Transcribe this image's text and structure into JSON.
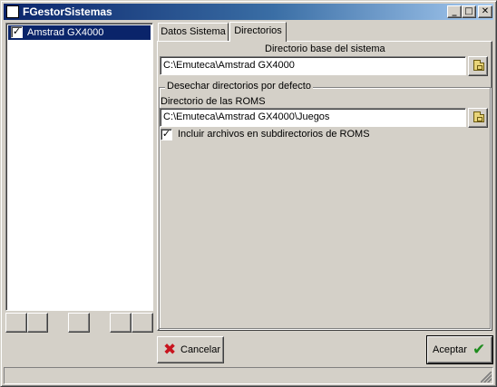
{
  "window": {
    "title": "FGestorSistemas",
    "controls": {
      "minimize_icon": "_",
      "maximize_icon": "□",
      "close_icon": "✕"
    }
  },
  "system_list": {
    "items": [
      {
        "label": "Amstrad GX4000",
        "checked": true,
        "check_mark": "✓"
      }
    ]
  },
  "tabs": [
    {
      "label": "Datos Sistema",
      "active": false
    },
    {
      "label": "Directorios",
      "active": true
    }
  ],
  "directorios": {
    "base_dir_label": "Directorio base del sistema",
    "base_dir_value": "C:\\Emuteca\\Amstrad GX4000",
    "group_title": "Desechar directorios por defecto",
    "roms_dir_label": "Directorio de las ROMS",
    "roms_dir_value": "C:\\Emuteca\\Amstrad GX4000\\Juegos",
    "include_subdirs_label": "Incluir archivos en subdirectorios de ROMS",
    "include_subdirs_checked": true,
    "check_mark": "✓"
  },
  "buttons": {
    "cancel_label": "Cancelar",
    "cancel_icon": "✖",
    "accept_label": "Aceptar",
    "accept_icon": "✔"
  },
  "colors": {
    "selection": "#0a246a",
    "cancel_icon": "#c8141e",
    "accept_icon": "#1e8c1e",
    "face": "#d4d0c8"
  }
}
